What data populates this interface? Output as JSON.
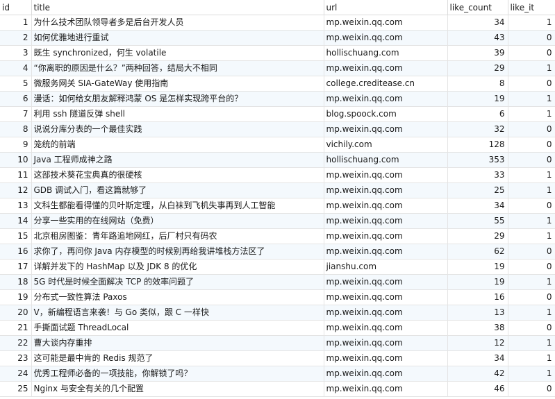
{
  "columns": [
    "id",
    "title",
    "url",
    "like_count",
    "like_it"
  ],
  "rows": [
    {
      "id": "1",
      "title": "为什么技术团队领导者多是后台开发人员",
      "url": "mp.weixin.qq.com",
      "like_count": "34",
      "like_it": "1"
    },
    {
      "id": "2",
      "title": "如何优雅地进行重试",
      "url": "mp.weixin.qq.com",
      "like_count": "43",
      "like_it": "0"
    },
    {
      "id": "3",
      "title": "既生 synchronized，何生 volatile",
      "url": "hollischuang.com",
      "like_count": "39",
      "like_it": "0"
    },
    {
      "id": "4",
      "title": "“你离职的原因是什么？”两种回答，结局大不相同",
      "url": "mp.weixin.qq.com",
      "like_count": "29",
      "like_it": "1"
    },
    {
      "id": "5",
      "title": "微服务网关 SIA-GateWay 使用指南",
      "url": "college.creditease.cn",
      "like_count": "8",
      "like_it": "0"
    },
    {
      "id": "6",
      "title": "漫话：如何给女朋友解释鸿蒙 OS 是怎样实现跨平台的？",
      "url": "mp.weixin.qq.com",
      "like_count": "19",
      "like_it": "1"
    },
    {
      "id": "7",
      "title": "利用 ssh 隧道反弹 shell",
      "url": "blog.spoock.com",
      "like_count": "6",
      "like_it": "1"
    },
    {
      "id": "8",
      "title": "说说分库分表的一个最佳实践",
      "url": "mp.weixin.qq.com",
      "like_count": "32",
      "like_it": "0"
    },
    {
      "id": "9",
      "title": "笼统的前端",
      "url": "vichily.com",
      "like_count": "128",
      "like_it": "0"
    },
    {
      "id": "10",
      "title": "Java 工程师成神之路",
      "url": "hollischuang.com",
      "like_count": "353",
      "like_it": "0"
    },
    {
      "id": "11",
      "title": "这部技术葵花宝典真的很硬核",
      "url": "mp.weixin.qq.com",
      "like_count": "33",
      "like_it": "1"
    },
    {
      "id": "12",
      "title": "GDB 调试入门，看这篇就够了",
      "url": "mp.weixin.qq.com",
      "like_count": "25",
      "like_it": "1"
    },
    {
      "id": "13",
      "title": "文科生都能看得懂的贝叶斯定理，从白袜到飞机失事再到人工智能",
      "url": "mp.weixin.qq.com",
      "like_count": "34",
      "like_it": "0"
    },
    {
      "id": "14",
      "title": "分享一些实用的在线网站（免费）",
      "url": "mp.weixin.qq.com",
      "like_count": "55",
      "like_it": "1"
    },
    {
      "id": "15",
      "title": "北京租房图鉴：青年路追地网红，后厂村只有码农",
      "url": "mp.weixin.qq.com",
      "like_count": "29",
      "like_it": "1"
    },
    {
      "id": "16",
      "title": "求你了，再问你 Java 内存模型的时候别再给我讲堆栈方法区了",
      "url": "mp.weixin.qq.com",
      "like_count": "62",
      "like_it": "0"
    },
    {
      "id": "17",
      "title": "详解并发下的 HashMap 以及 JDK 8 的优化",
      "url": "jianshu.com",
      "like_count": "19",
      "like_it": "0"
    },
    {
      "id": "18",
      "title": "5G 时代是时候全面解决 TCP 的效率问题了",
      "url": "mp.weixin.qq.com",
      "like_count": "19",
      "like_it": "1"
    },
    {
      "id": "19",
      "title": "分布式一致性算法 Paxos",
      "url": "mp.weixin.qq.com",
      "like_count": "16",
      "like_it": "0"
    },
    {
      "id": "20",
      "title": "V，新编程语言来袭！与 Go 类似，跟 C 一样快",
      "url": "mp.weixin.qq.com",
      "like_count": "13",
      "like_it": "1"
    },
    {
      "id": "21",
      "title": "手撕面试题 ThreadLocal",
      "url": "mp.weixin.qq.com",
      "like_count": "38",
      "like_it": "0"
    },
    {
      "id": "22",
      "title": "曹大谈内存重排",
      "url": "mp.weixin.qq.com",
      "like_count": "12",
      "like_it": "1"
    },
    {
      "id": "23",
      "title": "这可能是最中肯的 Redis 规范了",
      "url": "mp.weixin.qq.com",
      "like_count": "34",
      "like_it": "1"
    },
    {
      "id": "24",
      "title": "优秀工程师必备的一项技能，你解锁了吗？",
      "url": "mp.weixin.qq.com",
      "like_count": "42",
      "like_it": "1"
    },
    {
      "id": "25",
      "title": "Nginx 与安全有关的几个配置",
      "url": "mp.weixin.qq.com",
      "like_count": "46",
      "like_it": "0"
    }
  ]
}
